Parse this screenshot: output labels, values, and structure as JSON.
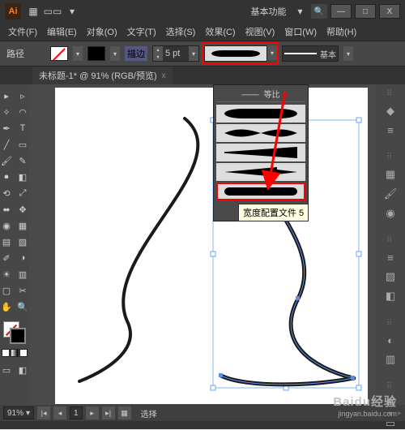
{
  "titlebar": {
    "logo": "Ai",
    "workspace_label": "基本功能",
    "minimize": "—",
    "restore": "□",
    "close": "X"
  },
  "menu": {
    "file": "文件(F)",
    "edit": "编辑(E)",
    "object": "对象(O)",
    "type": "文字(T)",
    "select": "选择(S)",
    "effect": "效果(C)",
    "view": "视图(V)",
    "window": "窗口(W)",
    "help": "帮助(H)"
  },
  "controlbar": {
    "path_label": "路径",
    "stroke_label": "描边",
    "pt_value": "5 pt",
    "brush_label": "基本"
  },
  "doctab": {
    "title": "未标题-1* @ 91% (RGB/预览)",
    "close": "x"
  },
  "profile_panel": {
    "header": "等比",
    "tooltip": "宽度配置文件 5"
  },
  "statusbar": {
    "zoom": "91%",
    "page": "1",
    "mode": "选择"
  },
  "watermark": {
    "brand": "Baidu经验",
    "url": "jingyan.baidu.com"
  },
  "tools": {
    "selection": "▸",
    "direct": "▹",
    "wand": "✧",
    "lasso": "◠",
    "pen": "✒",
    "type": "T",
    "line": "╱",
    "rect": "▭",
    "brush": "🖌",
    "pencil": "✎",
    "blob": "●",
    "eraser": "◧",
    "rotate": "⟲",
    "scale": "⤢",
    "width": "⬌",
    "free": "✥",
    "shape": "◉",
    "perspective": "▦",
    "mesh": "▤",
    "gradient": "▨",
    "eyedrop": "✐",
    "blend": "◑",
    "symbol": "☀",
    "graph": "▥",
    "artboard": "▢",
    "slice": "✂",
    "hand": "✋",
    "zoom": "🔍"
  },
  "right_icons": [
    "◆",
    "≡",
    "🖌",
    "◉",
    "◧",
    "T",
    "≡",
    "≣",
    "▭"
  ]
}
